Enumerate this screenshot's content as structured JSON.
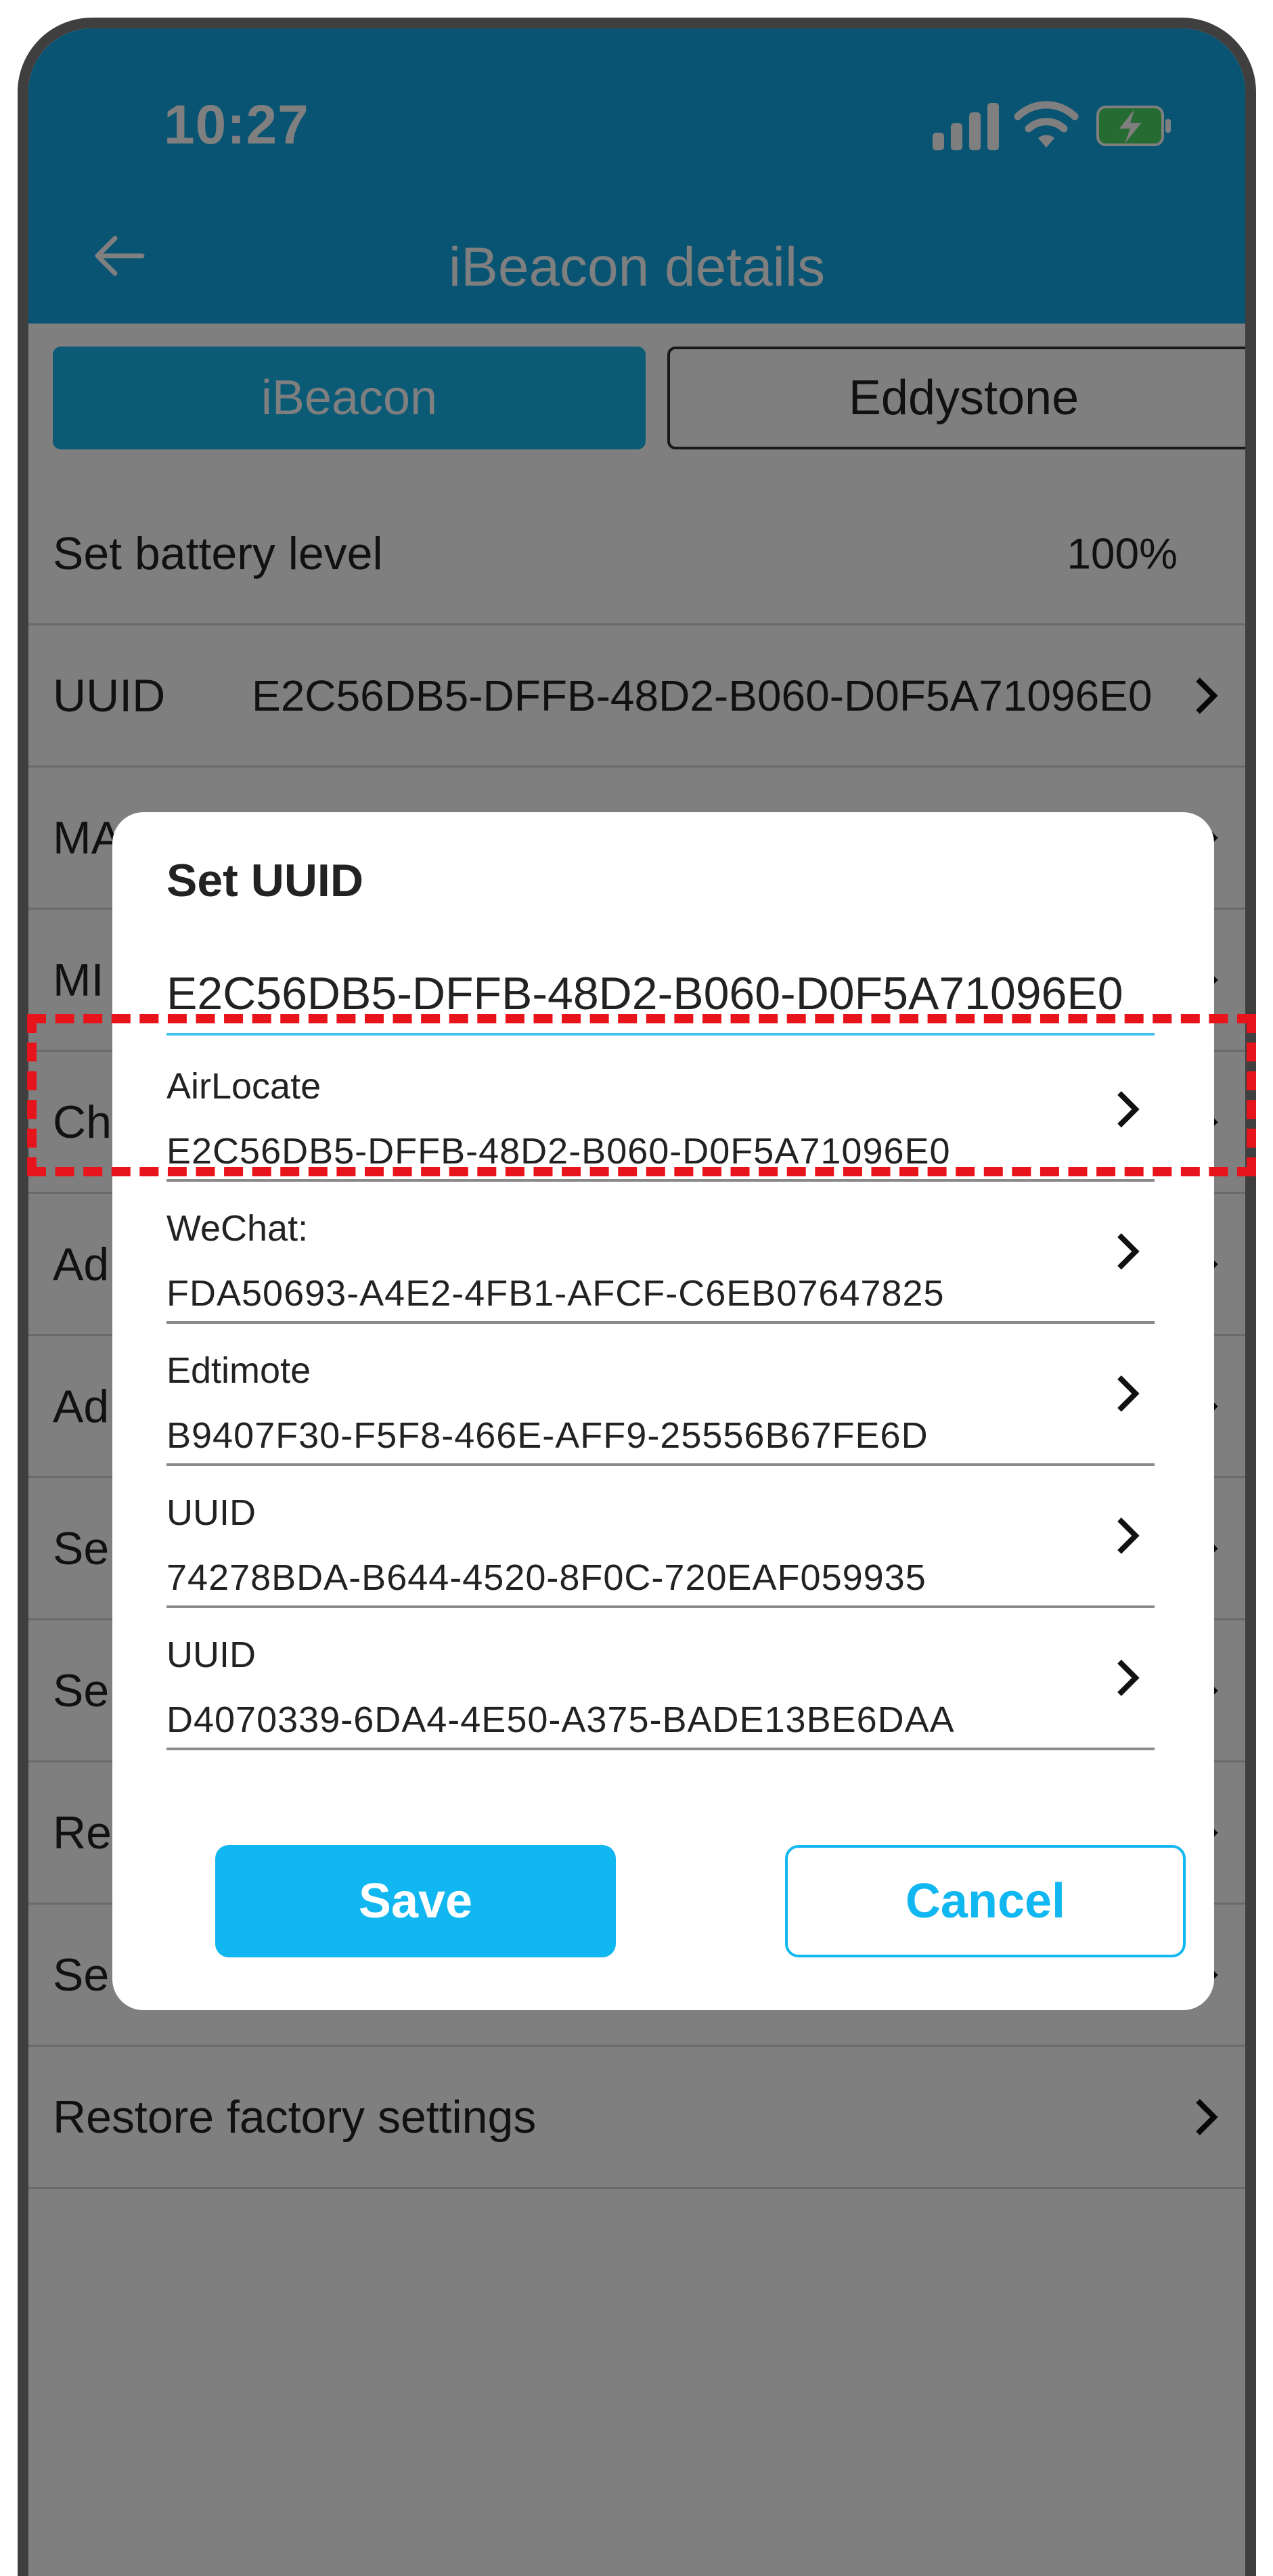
{
  "status_bar": {
    "time": "10:27"
  },
  "header": {
    "title": "iBeacon details"
  },
  "tabs": [
    {
      "label": "iBeacon",
      "selected": true
    },
    {
      "label": "Eddystone",
      "selected": false
    }
  ],
  "rows": [
    {
      "label": "Set battery level",
      "value": "100%"
    },
    {
      "label": "UUID",
      "value": "E2C56DB5-DFFB-48D2-B060-D0F5A71096E0"
    },
    {
      "label": "MA"
    },
    {
      "label": "MI"
    },
    {
      "label": "Ch"
    },
    {
      "label": "Ad"
    },
    {
      "label": "Ad"
    },
    {
      "label": "Se"
    },
    {
      "label": "Se"
    },
    {
      "label": "Re"
    },
    {
      "label": "Se"
    },
    {
      "label": "Restore factory settings"
    }
  ],
  "dialog": {
    "title": "Set UUID",
    "input_value": "E2C56DB5-DFFB-48D2-B060-D0F5A71096E0",
    "presets": [
      {
        "name": "AirLocate",
        "uuid": "E2C56DB5-DFFB-48D2-B060-D0F5A71096E0"
      },
      {
        "name": "WeChat:",
        "uuid": "FDA50693-A4E2-4FB1-AFCF-C6EB07647825"
      },
      {
        "name": "Edtimote",
        "uuid": "B9407F30-F5F8-466E-AFF9-25556B67FE6D"
      },
      {
        "name": "UUID",
        "uuid": "74278BDA-B644-4520-8F0C-720EAF059935"
      },
      {
        "name": "UUID",
        "uuid": "D4070339-6DA4-4E50-A375-BADE13BE6DAA"
      }
    ],
    "save_label": "Save",
    "cancel_label": "Cancel"
  },
  "colors": {
    "app_bar": "#12a9e6",
    "accent": "#11b7f0",
    "highlight": "#e8141c"
  },
  "icons": [
    "back-arrow-icon",
    "signal-icon",
    "wifi-icon",
    "battery-charging-icon",
    "chevron-right-icon"
  ]
}
